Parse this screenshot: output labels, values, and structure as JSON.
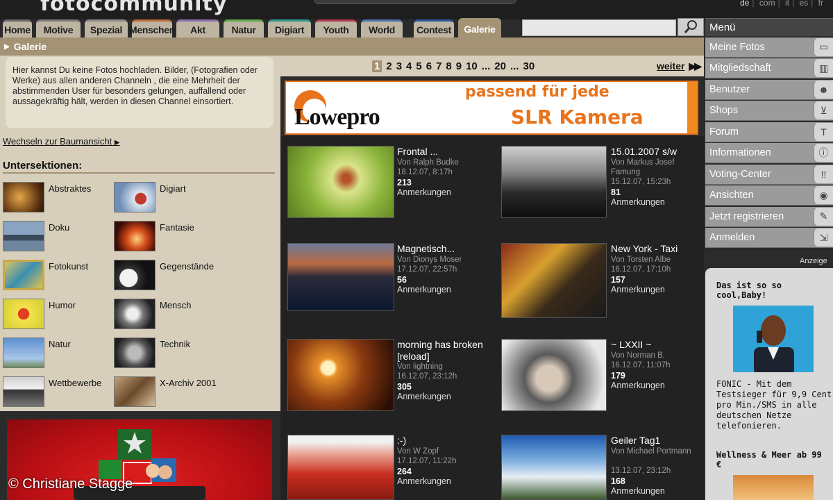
{
  "header": {
    "logo_text": "fotocommunity",
    "languages": [
      "de",
      "com",
      "it",
      "es",
      "fr"
    ],
    "current_language": "de"
  },
  "tabs": [
    {
      "label": "Home",
      "color": "#6a6a6a"
    },
    {
      "label": "Motive",
      "color": "#7a7a7a"
    },
    {
      "label": "Spezial",
      "color": "#8c8c8c"
    },
    {
      "label": "Menschen",
      "color": "#c06e3a"
    },
    {
      "label": "Akt",
      "color": "#8e6fb0"
    },
    {
      "label": "Natur",
      "color": "#5fa84b"
    },
    {
      "label": "Digiart",
      "color": "#2f9a8c"
    },
    {
      "label": "Youth",
      "color": "#b03a4c"
    },
    {
      "label": "World",
      "color": "#4a72a8"
    },
    {
      "label": "Contest",
      "color": "#2e5aa0"
    },
    {
      "label": "Galerie",
      "color": "#a49274",
      "active": true
    }
  ],
  "search": {
    "placeholder": "",
    "value": ""
  },
  "breadcrumb": "Galerie",
  "left": {
    "info_text": "Hier kannst Du keine Fotos hochladen. Bilder, (Fotografien oder Werke) aus allen anderen Channeln , die eine Mehrheit der abstimmenden User für besonders gelungen, auffallend oder aussagekräftig hält, werden in diesen Channel einsortiert.",
    "switch_link": "Wechseln zur Baumansicht",
    "subsections_title": "Untersektionen:",
    "subsections": [
      {
        "name": "Abstraktes"
      },
      {
        "name": "Digiart"
      },
      {
        "name": "Doku"
      },
      {
        "name": "Fantasie"
      },
      {
        "name": "Fotokunst"
      },
      {
        "name": "Gegenstände"
      },
      {
        "name": "Humor"
      },
      {
        "name": "Mensch"
      },
      {
        "name": "Natur"
      },
      {
        "name": "Technik"
      },
      {
        "name": "Wettbewerbe"
      },
      {
        "name": "X-Archiv 2001"
      }
    ]
  },
  "pagination": {
    "pages": [
      "1",
      "2",
      "3",
      "4",
      "5",
      "6",
      "7",
      "8",
      "9",
      "10",
      "...",
      "20",
      "...",
      "30"
    ],
    "current": "1",
    "next_label": "weiter"
  },
  "banner": {
    "brand": "Lowepro",
    "line1": "passend für jede",
    "line2": "SLR Kamera"
  },
  "photos": [
    {
      "title": "Frontal ...",
      "author": "Von Ralph Budke",
      "date": "18.12.07, 8:17h",
      "count": "213",
      "count_label": "Anmerkungen"
    },
    {
      "title": "15.01.2007 s/w",
      "author": "Von Markus Josef Famung",
      "date": "15.12.07, 15:23h",
      "count": "81",
      "count_label": "Anmerkungen"
    },
    {
      "title": "Magnetisch...",
      "author": "Von Dionys Moser",
      "date": "17.12.07, 22:57h",
      "count": "56",
      "count_label": "Anmerkungen"
    },
    {
      "title": "New York - Taxi",
      "author": "Von Torsten Albe",
      "date": "16.12.07, 17:10h",
      "count": "157",
      "count_label": "Anmerkungen"
    },
    {
      "title": "morning has broken [reload]",
      "author": "Von lightning",
      "date": "16.12.07, 23:12h",
      "count": "305",
      "count_label": "Anmerkungen"
    },
    {
      "title": "~ LXXII ~",
      "author": "Von Norman B.",
      "date": "16.12.07, 11:07h",
      "count": "179",
      "count_label": "Anmerkungen"
    },
    {
      "title": ":-)",
      "author": "Von W Zopf",
      "date": "17.12.07, 11:22h",
      "count": "264",
      "count_label": "Anmerkungen"
    },
    {
      "title": "Geiler Tag1",
      "author": "Von Michael Portmann",
      "date": "13.12.07, 23:12h",
      "count": "168",
      "count_label": "Anmerkungen"
    }
  ],
  "menu": {
    "title": "Menü",
    "items": [
      {
        "label": "Meine Fotos",
        "icon": "photos-icon"
      },
      {
        "label": "Mitgliedschaft",
        "icon": "membership-icon"
      },
      {
        "label": "Benutzer",
        "icon": "users-icon"
      },
      {
        "label": "Shops",
        "icon": "cart-icon"
      },
      {
        "label": "Forum",
        "icon": "forum-icon"
      },
      {
        "label": "Informationen",
        "icon": "info-icon"
      },
      {
        "label": "Voting-Center",
        "icon": "voting-icon"
      },
      {
        "label": "Ansichten",
        "icon": "eye-icon"
      },
      {
        "label": "Jetzt registrieren",
        "icon": "pencil-icon"
      },
      {
        "label": "Anmelden",
        "icon": "login-icon"
      }
    ]
  },
  "right_ad": {
    "anzeige_label": "Anzeige",
    "title": "Das ist so so cool,Baby!",
    "text": "FONIC - Mit dem Testsieger für 9,9 Cent pro Min./SMS in alle deutschen Netze telefonieren.",
    "title2": "Wellness & Meer ab 99 €"
  },
  "copyright": "© Christiane Stagge"
}
